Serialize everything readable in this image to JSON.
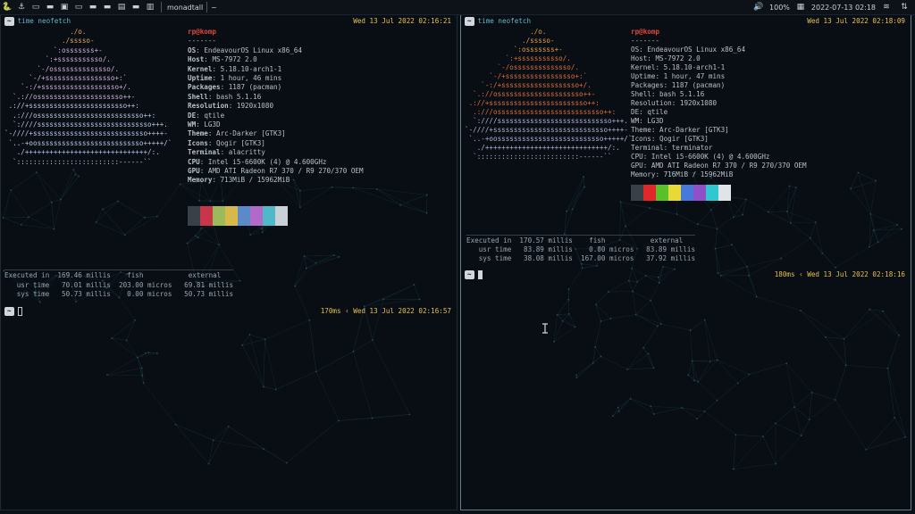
{
  "topbar": {
    "workspaces": [
      "python-icon",
      "anchor-icon",
      "terminal-icon",
      "folder-icon",
      "monitor-icon",
      "terminal-icon",
      "folder-icon",
      "folder-icon",
      "image-icon",
      "folder-icon",
      "doc-icon"
    ],
    "layout": "monadtall",
    "layout_sep": "~",
    "volume": "100%",
    "datetime": "2022-07-13 02:18",
    "tray": [
      "wifi-icon",
      "network-icon"
    ]
  },
  "left": {
    "prompt": "~",
    "command": "time neofetch",
    "timestamp": "Wed 13 Jul 2022 02:16:21",
    "logo": [
      "                ./o.",
      "              ./sssso-",
      "            `:osssssss+-",
      "          `:+sssssssssso/.",
      "        `-/ossssssssssssso/.",
      "      `-/+sssssssssssssssso+:`",
      "    `-:/+sssssssssssssssssso+/.",
      "  `.://osssssssssssssssssssso++-",
      " .://+ssssssssssssssssssssssso++:",
      "  .:///ossssssssssssssssssssssssso++:",
      "  `:////ssssssssssssssssssssssssssso+++.",
      "`-////+ssssssssssssssssssssssssssso++++-",
      " `..-+oossssssssssssssssssssssssso+++++/`",
      "   ./++++++++++++++++++++++++++++++/:.",
      "  `:::::::::::::::::::::::::------``"
    ],
    "user_host": "rp@komp",
    "separator": "-------",
    "info": [
      {
        "k": "OS",
        "v": "EndeavourOS Linux x86_64"
      },
      {
        "k": "Host",
        "v": "MS-7972 2.0"
      },
      {
        "k": "Kernel",
        "v": "5.18.10-arch1-1"
      },
      {
        "k": "Uptime",
        "v": "1 hour, 46 mins"
      },
      {
        "k": "Packages",
        "v": "1187 (pacman)"
      },
      {
        "k": "Shell",
        "v": "bash 5.1.16"
      },
      {
        "k": "Resolution",
        "v": "1920x1080"
      },
      {
        "k": "DE",
        "v": "qtile"
      },
      {
        "k": "WM",
        "v": "LG3D"
      },
      {
        "k": "Theme",
        "v": "Arc-Darker [GTK3]"
      },
      {
        "k": "Icons",
        "v": "Qogir [GTK3]"
      },
      {
        "k": "Terminal",
        "v": "alacritty"
      },
      {
        "k": "CPU",
        "v": "Intel i5-6600K (4) @ 4.600GHz"
      },
      {
        "k": "GPU",
        "v": "AMD ATI Radeon R7 370 / R9 270/370 OEM"
      },
      {
        "k": "Memory",
        "v": "713MiB / 15962MiB"
      }
    ],
    "colors": [
      "#3a4048",
      "#c8364a",
      "#9cba5a",
      "#d8b84a",
      "#5a8ac8",
      "#b06ac8",
      "#50b8c8",
      "#c8d0d8"
    ],
    "timing": [
      "________________________________________________________",
      "Executed in  169.46 millis    fish           external",
      "   usr time   70.01 millis  203.00 micros   69.81 millis",
      "   sys time   50.73 millis    0.00 micros   50.73 millis"
    ],
    "right_prompt": "170ms ‹ Wed 13 Jul 2022 02:16:57"
  },
  "right": {
    "prompt": "~",
    "command": "time neofetch",
    "timestamp": "Wed 13 Jul 2022 02:18:09",
    "logo": [
      "                ./o.",
      "              ./sssso-",
      "            `:osssssss+-",
      "          `:+sssssssssso/.",
      "        `-/ossssssssssssso/.",
      "      `-/+sssssssssssssssso+:`",
      "    `-:/+sssssssssssssssssso+/.",
      "  `.://osssssssssssssssssssso++-",
      " .://+ssssssssssssssssssssssso++:",
      "  .:///ossssssssssssssssssssssssso++:",
      "  `:////ssssssssssssssssssssssssssso+++.",
      "`-////+ssssssssssssssssssssssssssso++++-",
      " `..-+oossssssssssssssssssssssssso+++++/`",
      "   ./++++++++++++++++++++++++++++++/:.",
      "  `:::::::::::::::::::::::::------``"
    ],
    "user_host": "rp@komp",
    "separator": "-------",
    "info": [
      {
        "k": "OS",
        "v": "EndeavourOS Linux x86_64"
      },
      {
        "k": "Host",
        "v": "MS-7972 2.0"
      },
      {
        "k": "Kernel",
        "v": "5.18.10-arch1-1"
      },
      {
        "k": "Uptime",
        "v": "1 hour, 47 mins"
      },
      {
        "k": "Packages",
        "v": "1187 (pacman)"
      },
      {
        "k": "Shell",
        "v": "bash 5.1.16"
      },
      {
        "k": "Resolution",
        "v": "1920x1080"
      },
      {
        "k": "DE",
        "v": "qtile"
      },
      {
        "k": "WM",
        "v": "LG3D"
      },
      {
        "k": "Theme",
        "v": "Arc-Darker [GTK3]"
      },
      {
        "k": "Icons",
        "v": "Qogir [GTK3]"
      },
      {
        "k": "Terminal",
        "v": "terminator"
      },
      {
        "k": "CPU",
        "v": "Intel i5-6600K (4) @ 4.600GHz"
      },
      {
        "k": "GPU",
        "v": "AMD ATI Radeon R7 370 / R9 270/370 OEM"
      },
      {
        "k": "Memory",
        "v": "716MiB / 15962MiB"
      }
    ],
    "colors": [
      "#3a4048",
      "#e02828",
      "#58c028",
      "#e8d838",
      "#4878d8",
      "#9050c8",
      "#30c8d0",
      "#e0e4e8"
    ],
    "timing": [
      "________________________________________________________",
      "Executed in  170.57 millis    fish           external",
      "   usr time   83.89 millis    0.00 micros   83.89 millis",
      "   sys time   38.08 millis  167.00 micros   37.92 millis"
    ],
    "right_prompt": "180ms ‹ Wed 13 Jul 2022 02:18:16"
  }
}
